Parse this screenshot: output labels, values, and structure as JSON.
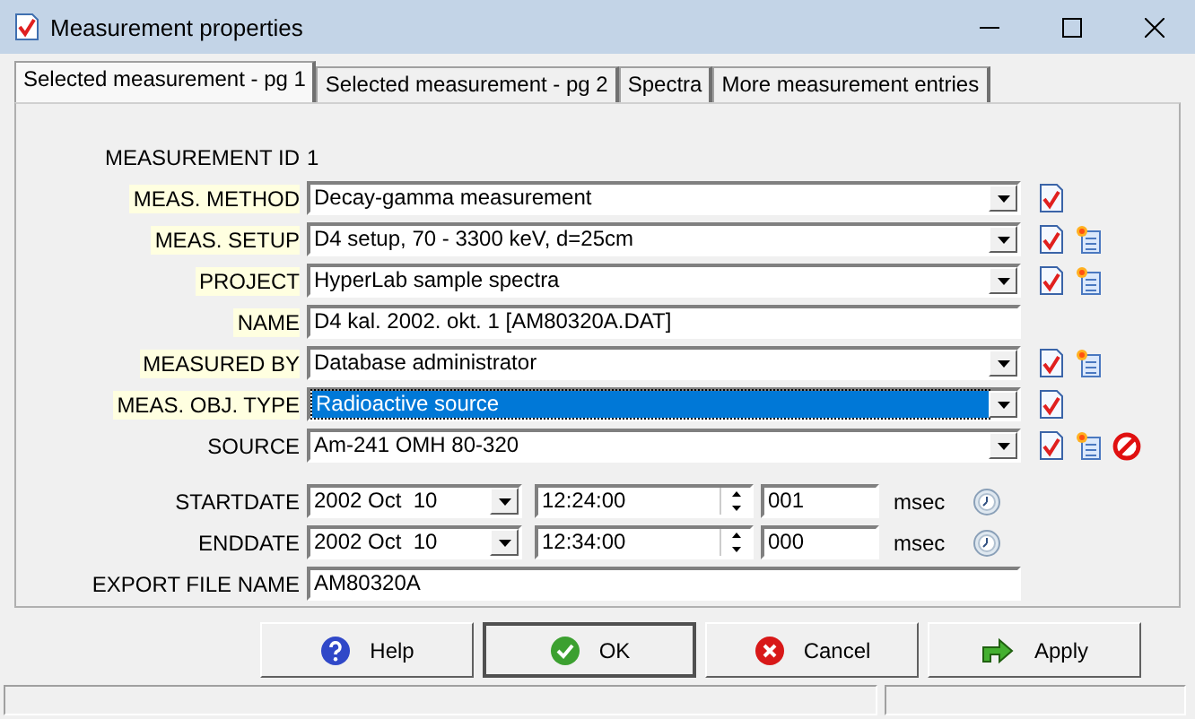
{
  "window": {
    "title": "Measurement properties"
  },
  "tabs": [
    {
      "label": "Selected measurement - pg 1",
      "selected": true
    },
    {
      "label": "Selected measurement - pg 2",
      "selected": false
    },
    {
      "label": "Spectra",
      "selected": false
    },
    {
      "label": "More measurement entries",
      "selected": false
    }
  ],
  "measurement_id": {
    "label": "MEASUREMENT ID",
    "value": "1"
  },
  "fields": [
    {
      "label": "MEAS. METHOD",
      "required": true,
      "kind": "combo",
      "value": "Decay-gamma measurement",
      "selected": false,
      "edit_button": true,
      "new_button": false,
      "delete_button": false
    },
    {
      "label": "MEAS. SETUP",
      "required": true,
      "kind": "combo",
      "value": "D4 setup, 70 - 3300 keV, d=25cm",
      "selected": false,
      "edit_button": true,
      "new_button": true,
      "delete_button": false
    },
    {
      "label": "PROJECT",
      "required": true,
      "kind": "combo",
      "value": "HyperLab sample spectra",
      "selected": false,
      "edit_button": true,
      "new_button": true,
      "delete_button": false
    },
    {
      "label": "NAME",
      "required": true,
      "kind": "text",
      "value": "D4 kal. 2002. okt. 1 [AM80320A.DAT]",
      "selected": false,
      "edit_button": false,
      "new_button": false,
      "delete_button": false
    },
    {
      "label": "MEASURED BY",
      "required": true,
      "kind": "combo",
      "value": "Database administrator",
      "selected": false,
      "edit_button": true,
      "new_button": true,
      "delete_button": false
    },
    {
      "label": "MEAS. OBJ. TYPE",
      "required": true,
      "kind": "combo",
      "value": "Radioactive source",
      "selected": true,
      "edit_button": true,
      "new_button": false,
      "delete_button": false
    },
    {
      "label": "SOURCE",
      "required": false,
      "kind": "combo",
      "value": "Am-241 OMH 80-320",
      "selected": false,
      "edit_button": true,
      "new_button": true,
      "delete_button": true
    }
  ],
  "dates": [
    {
      "label": "STARTDATE",
      "date": "2002 Oct  10",
      "time": "12:24:00",
      "msec": "001",
      "unit": "msec"
    },
    {
      "label": "ENDDATE",
      "date": "2002 Oct  10",
      "time": "12:34:00",
      "msec": "000",
      "unit": "msec"
    }
  ],
  "export": {
    "label": "EXPORT FILE NAME",
    "value": "AM80320A"
  },
  "buttons": [
    {
      "label": "Help",
      "kind": "help"
    },
    {
      "label": "OK",
      "kind": "ok"
    },
    {
      "label": "Cancel",
      "kind": "cancel"
    },
    {
      "label": "Apply",
      "kind": "apply"
    }
  ]
}
